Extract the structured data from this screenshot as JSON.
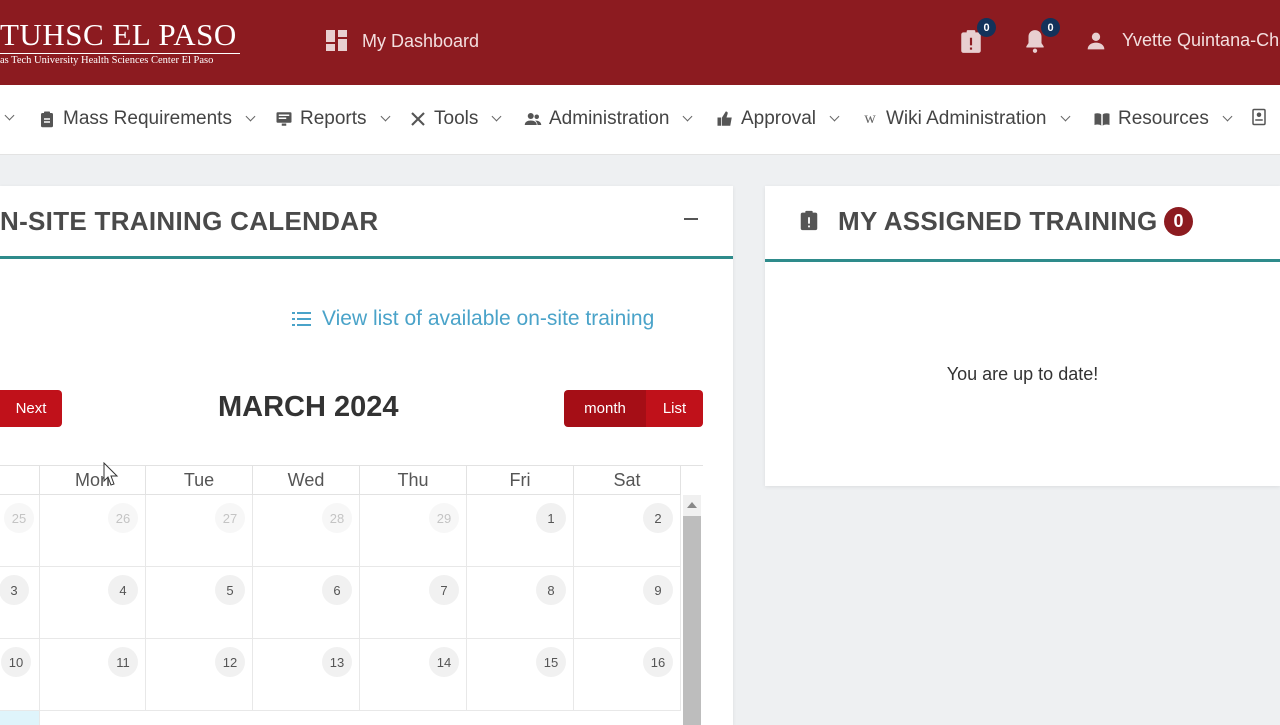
{
  "header": {
    "logo_title": "TUHSC EL PASO",
    "logo_subtitle": "as Tech University Health Sciences Center El Paso",
    "dashboard_label": "My Dashboard",
    "tasks_count": "0",
    "notifications_count": "0",
    "user_name": "Yvette Quintana-Cha"
  },
  "nav": {
    "items": [
      {
        "label": "Mass Requirements"
      },
      {
        "label": "Reports"
      },
      {
        "label": "Tools"
      },
      {
        "label": "Administration"
      },
      {
        "label": "Approval"
      },
      {
        "label": "Wiki Administration"
      },
      {
        "label": "Resources"
      }
    ]
  },
  "calendar_card": {
    "title": "N-SITE TRAINING CALENDAR",
    "list_link": "View list of available on-site training",
    "next_label": "Next",
    "month_title": "MARCH 2024",
    "view_month": "month",
    "view_list": "List",
    "weekdays": [
      "Mon",
      "Tue",
      "Wed",
      "Thu",
      "Fri",
      "Sat"
    ],
    "weeks": [
      {
        "sun": "",
        "days": [
          "26",
          "27",
          "28",
          "29",
          "1",
          "2"
        ]
      },
      {
        "sun": "3",
        "days": [
          "4",
          "5",
          "6",
          "7",
          "8",
          "9"
        ]
      },
      {
        "sun": "10",
        "days": [
          "11",
          "12",
          "13",
          "14",
          "15",
          "16"
        ]
      }
    ],
    "first_week_partial_sun": "25"
  },
  "assigned_card": {
    "title": "MY ASSIGNED TRAINING",
    "count": "0",
    "message": "You are up to date!"
  },
  "colors": {
    "brand": "#8c1b20",
    "button_red": "#c0111a",
    "accent_teal": "#2e8b8b",
    "link_blue": "#4aa3c9"
  }
}
